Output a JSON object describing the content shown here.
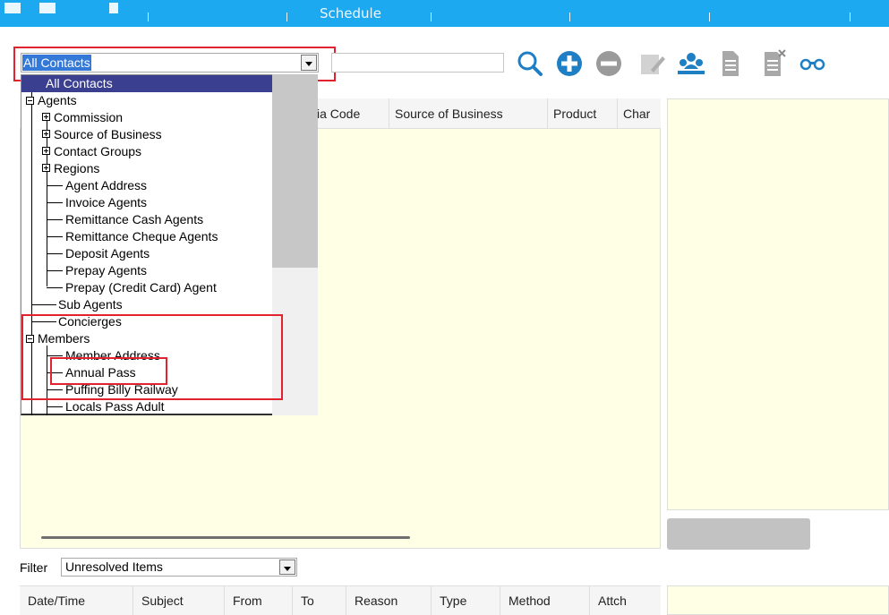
{
  "topbar": {
    "tab_label": "Schedule"
  },
  "contact_selector": {
    "selected": "All Contacts"
  },
  "search": {
    "placeholder": ""
  },
  "toolbar": {
    "icons": [
      "search-icon",
      "add-icon",
      "remove-icon",
      "edit-icon",
      "contacts-icon",
      "document-icon",
      "delete-document-icon",
      "binoculars-icon"
    ]
  },
  "grid": {
    "columns": [
      "ia Code",
      "Source of Business",
      "Product",
      "Char"
    ]
  },
  "tree": {
    "items": [
      {
        "label": "All Contacts"
      },
      {
        "label": "Agents"
      },
      {
        "label": "Commission"
      },
      {
        "label": "Source of Business"
      },
      {
        "label": "Contact Groups"
      },
      {
        "label": "Regions"
      },
      {
        "label": "Agent Address"
      },
      {
        "label": "Invoice Agents"
      },
      {
        "label": "Remittance Cash Agents"
      },
      {
        "label": "Remittance Cheque Agents"
      },
      {
        "label": "Deposit Agents"
      },
      {
        "label": "Prepay Agents"
      },
      {
        "label": "Prepay (Credit Card) Agent"
      },
      {
        "label": "Sub Agents"
      },
      {
        "label": "Concierges"
      },
      {
        "label": "Members"
      },
      {
        "label": "Member Address"
      },
      {
        "label": "Annual Pass"
      },
      {
        "label": "Puffing Billy Railway"
      },
      {
        "label": "Locals Pass Adult"
      }
    ]
  },
  "filter": {
    "label": "Filter",
    "value": "Unresolved Items"
  },
  "bottom_grid": {
    "columns": [
      "Date/Time",
      "Subject",
      "From",
      "To",
      "Reason",
      "Type",
      "Method",
      "Attch"
    ]
  },
  "colors": {
    "topbar": "#1ca9f0",
    "icon_blue": "#1f7fc4",
    "highlight": "#e0232f",
    "panel": "#ffffe6"
  }
}
